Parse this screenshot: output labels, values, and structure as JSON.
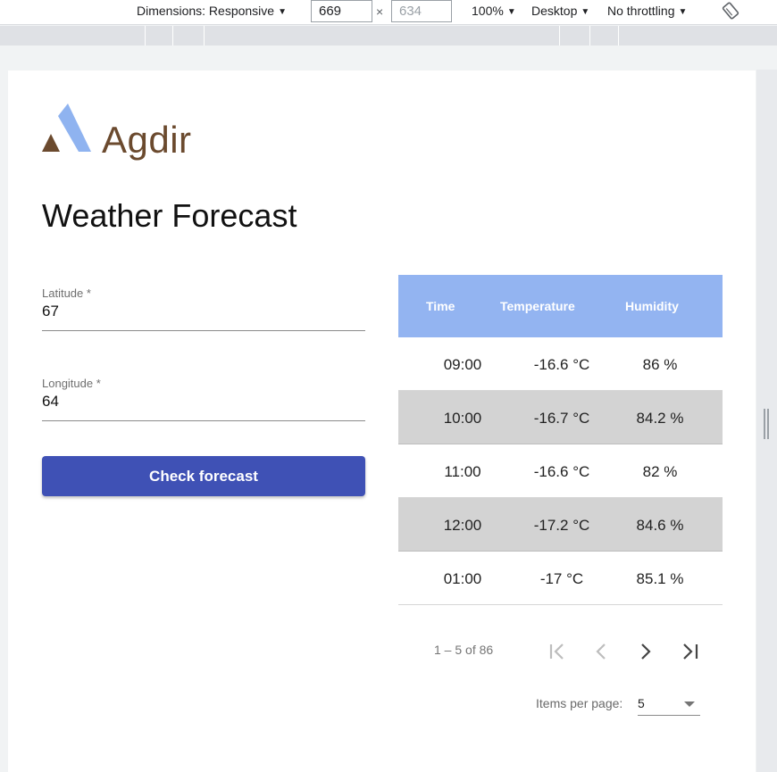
{
  "devtools": {
    "dimensions_label": "Dimensions: Responsive",
    "width_value": "669",
    "height_placeholder": "634",
    "times": "×",
    "zoom": "100%",
    "device": "Desktop",
    "throttling": "No throttling",
    "rotate_icon": "rotate-icon"
  },
  "brand": {
    "logo_text": "Agdir",
    "accent_blue": "#8fb3f0",
    "accent_brown": "#6b4a2e"
  },
  "page": {
    "title": "Weather Forecast"
  },
  "form": {
    "latitude_label": "Latitude *",
    "latitude_value": "67",
    "longitude_label": "Longitude *",
    "longitude_value": "64",
    "submit_label": "Check forecast",
    "button_color": "#3f51b5"
  },
  "table": {
    "header_color": "#93b4f1",
    "columns": [
      "Time",
      "Temperature",
      "Humidity"
    ],
    "rows": [
      {
        "time": "09:00",
        "temperature": "-16.6 °C",
        "humidity": "86 %"
      },
      {
        "time": "10:00",
        "temperature": "-16.7 °C",
        "humidity": "84.2 %"
      },
      {
        "time": "11:00",
        "temperature": "-16.6 °C",
        "humidity": "82 %"
      },
      {
        "time": "12:00",
        "temperature": "-17.2 °C",
        "humidity": "84.6 %"
      },
      {
        "time": "01:00",
        "temperature": "-17 °C",
        "humidity": "85.1 %"
      }
    ]
  },
  "paginator": {
    "range_label": "1 – 5 of 86",
    "items_per_page_label": "Items per page:",
    "items_per_page_value": "5"
  }
}
